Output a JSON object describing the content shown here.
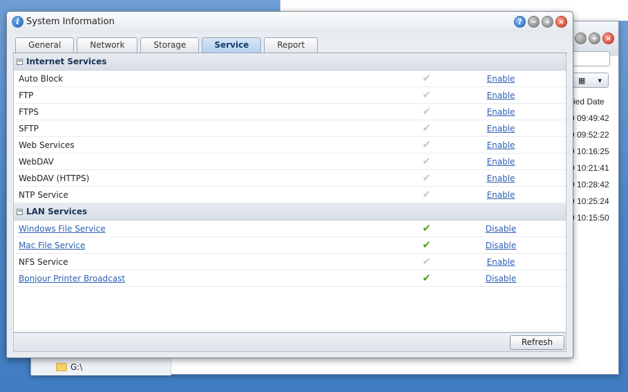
{
  "window": {
    "title": "System Information",
    "controls": [
      "?",
      "−",
      "+",
      "×"
    ]
  },
  "tabs": [
    {
      "label": "General",
      "active": false
    },
    {
      "label": "Network",
      "active": false
    },
    {
      "label": "Storage",
      "active": false
    },
    {
      "label": "Service",
      "active": true
    },
    {
      "label": "Report",
      "active": false
    }
  ],
  "groups": {
    "internet": {
      "title": "Internet Services",
      "collapse_symbol": "−",
      "rows": [
        {
          "name": "Auto Block",
          "status": "✔",
          "action": "Enable"
        },
        {
          "name": "FTP",
          "status": "✔",
          "action": "Enable"
        },
        {
          "name": "FTPS",
          "status": "✔",
          "action": "Enable"
        },
        {
          "name": "SFTP",
          "status": "✔",
          "action": "Enable"
        },
        {
          "name": "Web Services",
          "status": "✔",
          "action": "Enable"
        },
        {
          "name": "WebDAV",
          "status": "✔",
          "action": "Enable"
        },
        {
          "name": "WebDAV (HTTPS)",
          "status": "✔",
          "action": "Enable"
        },
        {
          "name": "NTP Service",
          "status": "✔",
          "action": "Enable"
        }
      ]
    },
    "lan": {
      "title": "LAN Services",
      "collapse_symbol": "−",
      "rows": [
        {
          "name": "Windows File Service",
          "status": "✔",
          "action": "Disable"
        },
        {
          "name": "Mac File Service",
          "status": "✔",
          "action": "Disable"
        },
        {
          "name": "NFS Service",
          "status": "✔",
          "action": "Enable"
        },
        {
          "name": "Bonjour Printer Broadcast",
          "status": "✔",
          "action": "Disable"
        }
      ]
    }
  },
  "footer": {
    "refresh_label": "Refresh"
  },
  "background_window": {
    "column_header": "ied Date",
    "times": [
      "9 09:49:42",
      "9 09:52:22",
      "9 10:16:25",
      "9 10:21:41",
      "9 10:28:42",
      "9 10:25:24",
      "9 10:15:50"
    ],
    "drive_label": "G:\\"
  },
  "colors": {
    "enabled_check": "#4fa31c",
    "disabled_check": "#c4c8cd",
    "link": "#2d5fb3",
    "active_tab": "#b5d0ee"
  }
}
